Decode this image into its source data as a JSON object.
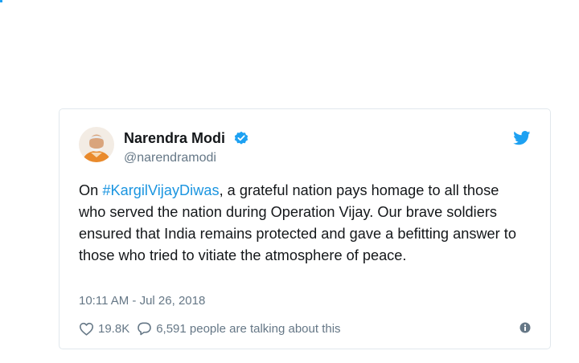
{
  "tweet": {
    "author_name": "Narendra Modi",
    "author_handle": "@narendramodi",
    "text_before": "On ",
    "hashtag": "#KargilVijayDiwas",
    "text_after": ", a grateful nation pays homage to all those who served the nation during Operation Vijay. Our brave soldiers ensured that India remains protected and gave a befitting answer to those who tried to vitiate the atmosphere of peace.",
    "timestamp": "10:11 AM - Jul 26, 2018",
    "like_count": "19.8K",
    "talking_text": "6,591 people are talking about this"
  },
  "icons": {
    "avatar": "avatar",
    "verified": "verified-badge-icon",
    "brand": "twitter-bird-icon",
    "like": "heart-icon",
    "reply": "speech-bubble-icon",
    "info": "info-icon"
  },
  "colors": {
    "accent": "#1da1f2",
    "hashtag": "#1b95e0",
    "text": "#14171a",
    "secondary_text": "#657786",
    "card_border": "#e1e8ed"
  }
}
